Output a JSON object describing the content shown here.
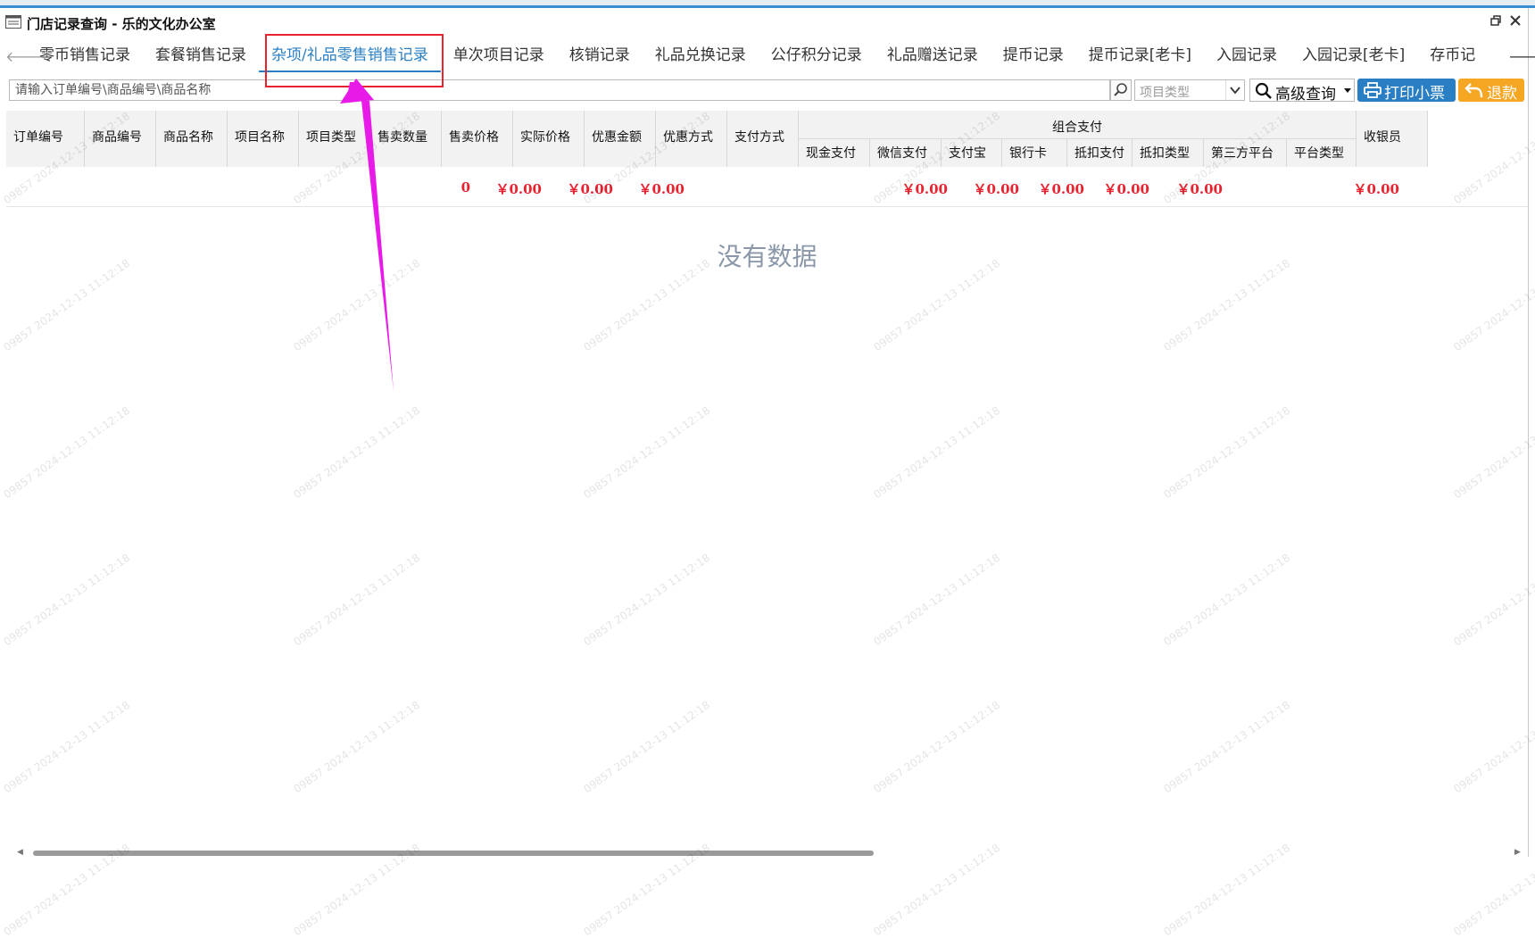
{
  "window": {
    "title": "门店记录查询 - 乐的文化办公室"
  },
  "tabs": [
    {
      "label": "零币销售记录",
      "active": false
    },
    {
      "label": "套餐销售记录",
      "active": false
    },
    {
      "label": "杂项/礼品零售销售记录",
      "active": true
    },
    {
      "label": "单次项目记录",
      "active": false
    },
    {
      "label": "核销记录",
      "active": false
    },
    {
      "label": "礼品兑换记录",
      "active": false
    },
    {
      "label": "公仔积分记录",
      "active": false
    },
    {
      "label": "礼品赠送记录",
      "active": false
    },
    {
      "label": "提币记录",
      "active": false
    },
    {
      "label": "提币记录[老卡]",
      "active": false
    },
    {
      "label": "入园记录",
      "active": false
    },
    {
      "label": "入园记录[老卡]",
      "active": false
    },
    {
      "label": "存币记",
      "active": false
    }
  ],
  "toolbar": {
    "search_placeholder": "请输入订单编号\\商品编号\\商品名称",
    "search_value": "",
    "select_placeholder": "项目类型",
    "advanced_label": "高级查询",
    "print_label": "打印小票",
    "refund_label": "退款"
  },
  "grid": {
    "columns": [
      "订单编号",
      "商品编号",
      "商品名称",
      "项目名称",
      "项目类型",
      "售卖数量",
      "售卖价格",
      "实际价格",
      "优惠金额",
      "优惠方式",
      "支付方式"
    ],
    "group_label": "组合支付",
    "group_columns": [
      "现金支付",
      "微信支付",
      "支付宝",
      "银行卡",
      "抵扣支付",
      "抵扣类型",
      "第三方平台",
      "平台类型"
    ],
    "last_column": "收银员",
    "summary": {
      "qty": "0",
      "sale_price": "￥0.00",
      "actual_price": "￥0.00",
      "discount": "￥0.00",
      "cash": "￥0.00",
      "wechat": "￥0.00",
      "alipay": "￥0.00",
      "bank": "￥0.00",
      "deduct": "￥0.00",
      "third_party": "￥0.00"
    },
    "empty_text": "没有数据"
  },
  "watermark": "09857 2024-12-13 11:12:18",
  "colors": {
    "accent": "#2a7fc4",
    "refund": "#f5a623",
    "highlight": "#e8232f",
    "arrow": "#e81ae8",
    "sum_text": "#e8232f"
  }
}
